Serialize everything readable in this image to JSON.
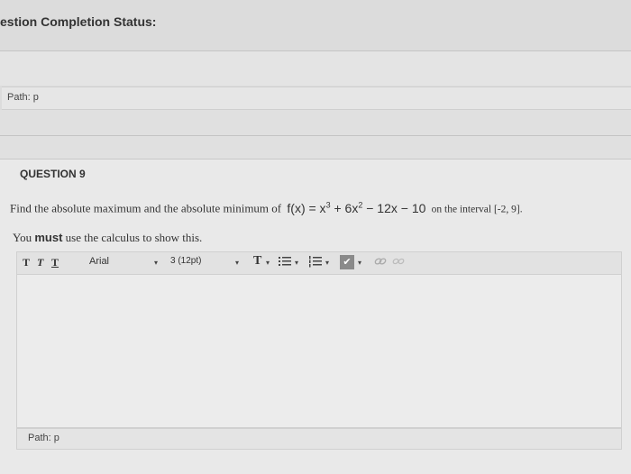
{
  "status": {
    "title": "estion Completion Status:"
  },
  "top_path": {
    "label": "Path: p"
  },
  "question": {
    "title": "QUESTION 9",
    "prompt_prefix": "Find the absolute maximum and the absolute minimum of",
    "function_lhs": "f(x) = x",
    "exp1": "3",
    "function_mid": " + 6x",
    "exp2": "2",
    "function_rest": " − 12x − 10",
    "interval_text": "on the interval [-2, 9].",
    "instruction_prefix": "You",
    "instruction_bold": "must",
    "instruction_suffix": "use the calculus to show this."
  },
  "toolbar": {
    "format_t1": "T",
    "format_t2": "T",
    "format_t3": "T",
    "font_family": "Arial",
    "font_size": "3 (12pt)",
    "text_color_label": "T",
    "dropdown_arrow": "▾"
  },
  "editor": {
    "path_label": "Path: p"
  }
}
